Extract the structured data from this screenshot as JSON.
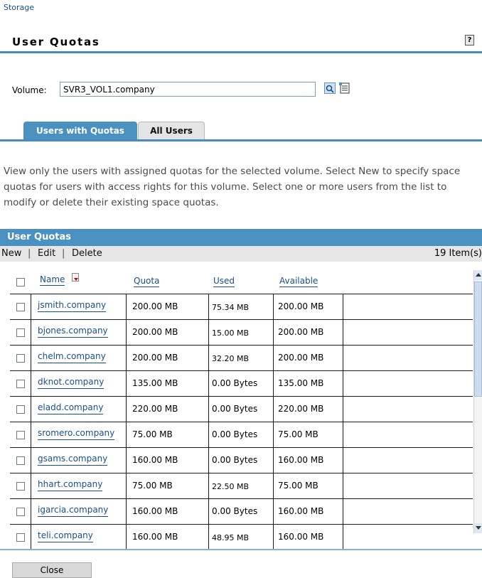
{
  "breadcrumb": "Storage",
  "page_title": "User Quotas",
  "help_icon": "help-icon",
  "volume": {
    "label": "Volume:",
    "value": "SVR3_VOL1.company",
    "search_icon": "search-icon",
    "browse_icon": "object-browser-icon"
  },
  "tabs": [
    {
      "label": "Users with Quotas",
      "active": true
    },
    {
      "label": "All Users",
      "active": false
    }
  ],
  "description": "View only the users with assigned quotas for the selected volume. Select New to specify space quotas for users with access rights for this volume. Select one or more users from the list to modify or delete their existing space quotas.",
  "panel": {
    "title": "User Quotas",
    "toolbar": {
      "new": "New",
      "edit": "Edit",
      "delete": "Delete",
      "sep": "|"
    },
    "item_count": "19 Item(s)",
    "columns": {
      "name": "Name",
      "quota": "Quota",
      "used": "Used",
      "available": "Available"
    },
    "rows": [
      {
        "name": "jsmith.company",
        "quota": "200.00 MB",
        "used": "75.34 MB",
        "available": "200.00 MB"
      },
      {
        "name": "bjones.company",
        "quota": "200.00 MB",
        "used": "15.00 MB",
        "available": "200.00 MB"
      },
      {
        "name": "chelm.company",
        "quota": "200.00 MB",
        "used": "32.20 MB",
        "available": "200.00 MB"
      },
      {
        "name": "dknot.company",
        "quota": "135.00 MB",
        "used": "0.00 Bytes",
        "available": "135.00 MB"
      },
      {
        "name": "eladd.company",
        "quota": "220.00 MB",
        "used": "0.00 Bytes",
        "available": "220.00 MB"
      },
      {
        "name": "sromero.company",
        "quota": "75.00 MB",
        "used": "0.00 Bytes",
        "available": "75.00 MB"
      },
      {
        "name": "gsams.company",
        "quota": "160.00 MB",
        "used": "0.00 Bytes",
        "available": "160.00 MB"
      },
      {
        "name": "hhart.company",
        "quota": "75.00 MB",
        "used": "22.50 MB",
        "available": "75.00 MB"
      },
      {
        "name": "igarcia.company",
        "quota": "160.00 MB",
        "used": "0.00 Bytes",
        "available": "160.00 MB"
      },
      {
        "name": "teli.company",
        "quota": "160.00 MB",
        "used": "48.95 MB",
        "available": "160.00 MB"
      }
    ]
  },
  "close_label": "Close",
  "colors": {
    "accent": "#4a90c0",
    "link": "#1a4e8a",
    "toolbar_bg": "#e6e6e6"
  }
}
